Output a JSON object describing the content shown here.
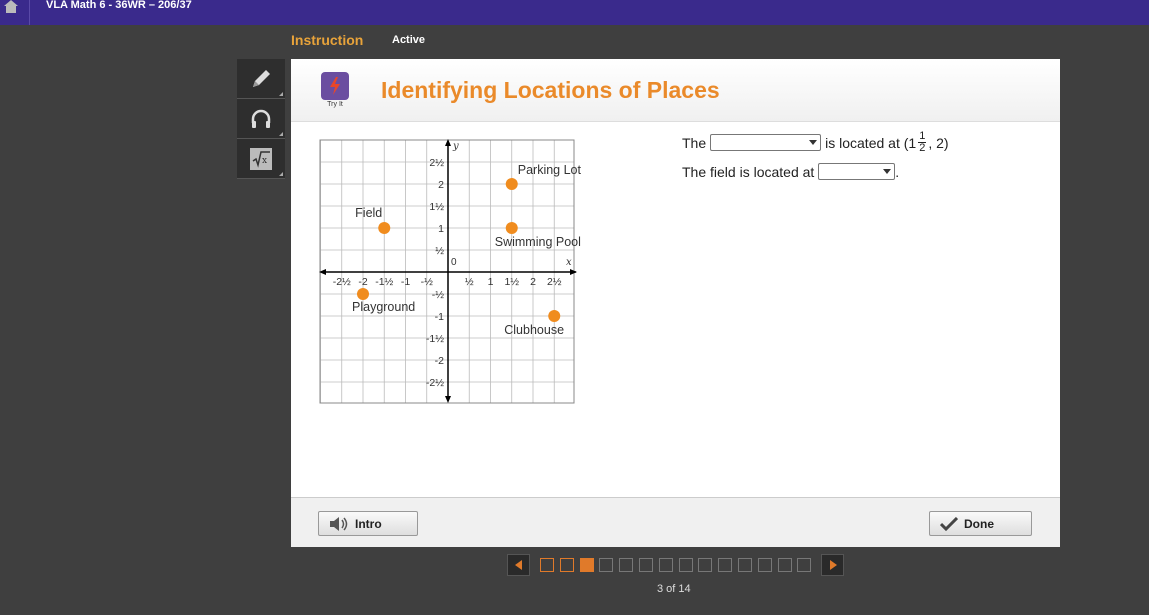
{
  "app": {
    "title": "VLA Math 6 - 36WR – 206/37"
  },
  "nav": {
    "instruction": "Instruction",
    "active": "Active"
  },
  "tools": [
    "pencil-icon",
    "headphones-icon",
    "calculator-icon"
  ],
  "header": {
    "tryit_label": "Try It",
    "title": "Identifying Locations of Places"
  },
  "graph": {
    "axis_x_label": "x",
    "axis_y_label": "y",
    "origin_label": "0",
    "x_ticks": [
      "-2½",
      "-2",
      "-1½",
      "-1",
      "-½",
      "½",
      "1",
      "1½",
      "2",
      "2½"
    ],
    "y_ticks": [
      "2½",
      "2",
      "1½",
      "1",
      "½",
      "-½",
      "-1",
      "-1½",
      "-2",
      "-2½"
    ],
    "point_color": "#f08c1e",
    "points": [
      {
        "label": "Parking Lot",
        "x": 1.5,
        "y": 2
      },
      {
        "label": "Field",
        "x": -1.5,
        "y": 1
      },
      {
        "label": "Swimming Pool",
        "x": 1.5,
        "y": 1
      },
      {
        "label": "Playground",
        "x": -2,
        "y": -0.5
      },
      {
        "label": "Clubhouse",
        "x": 2.5,
        "y": -1
      }
    ]
  },
  "questions": {
    "q1_before": "The",
    "q1_after": "is located at (1",
    "q1_frac_num": "1",
    "q1_frac_den": "2",
    "q1_end": ", 2)",
    "q1_select_value": "",
    "q2_before": "The field is located at",
    "q2_select_value": "",
    "q2_end": "."
  },
  "footer": {
    "intro_label": "Intro",
    "done_label": "Done"
  },
  "pager": {
    "current": 3,
    "total": 14,
    "count_text": "3 of 14"
  }
}
